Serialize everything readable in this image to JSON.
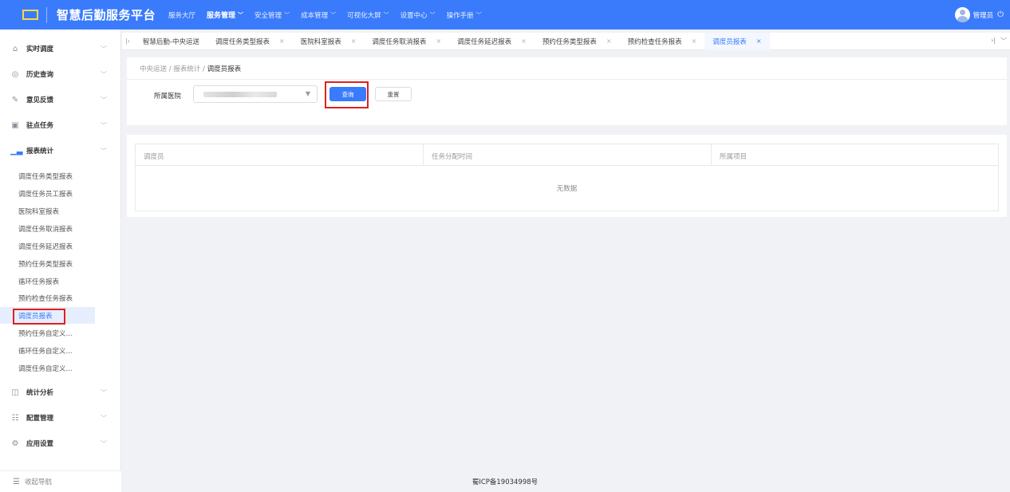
{
  "header": {
    "app_title": "智慧后勤服务平台",
    "nav": [
      {
        "label": "服务大厅",
        "caret": false,
        "active": false
      },
      {
        "label": "服务管理",
        "caret": true,
        "active": true
      },
      {
        "label": "安全管理",
        "caret": true,
        "active": false
      },
      {
        "label": "成本管理",
        "caret": true,
        "active": false
      },
      {
        "label": "可视化大屏",
        "caret": true,
        "active": false
      },
      {
        "label": "设置中心",
        "caret": true,
        "active": false
      },
      {
        "label": "操作手册",
        "caret": true,
        "active": false
      }
    ],
    "user_label": "管理员",
    "colors": {
      "brand": "#3a7bfc",
      "logo": "#f7d84a",
      "highlight": "#e02020"
    }
  },
  "sidebar": {
    "sections_top": [
      {
        "label": "实时调度",
        "icon": "home-icon"
      },
      {
        "label": "历史查询",
        "icon": "history-icon"
      },
      {
        "label": "意见反馈",
        "icon": "edit-icon"
      },
      {
        "label": "驻点任务",
        "icon": "box-icon"
      },
      {
        "label": "报表统计",
        "icon": "bar-chart-icon"
      }
    ],
    "sub_items": [
      {
        "label": "调度任务类型报表",
        "active": false
      },
      {
        "label": "调度任务员工报表",
        "active": false
      },
      {
        "label": "医院科室报表",
        "active": false
      },
      {
        "label": "调度任务取消报表",
        "active": false
      },
      {
        "label": "调度任务延迟报表",
        "active": false
      },
      {
        "label": "预约任务类型报表",
        "active": false
      },
      {
        "label": "循环任务报表",
        "active": false
      },
      {
        "label": "预约检查任务报表",
        "active": false
      },
      {
        "label": "调度员报表",
        "active": true
      },
      {
        "label": "预约任务自定义...",
        "active": false
      },
      {
        "label": "循环任务自定义...",
        "active": false
      },
      {
        "label": "调度任务自定义...",
        "active": false
      }
    ],
    "sections_bottom": [
      {
        "label": "统计分析",
        "icon": "analytics-icon"
      },
      {
        "label": "配置管理",
        "icon": "list-config-icon"
      },
      {
        "label": "应用设置",
        "icon": "settings-icon"
      }
    ],
    "collapse_label": "收起导航"
  },
  "tabs": [
    {
      "label": "智慧后勤-中央运送",
      "closable": false,
      "active": false
    },
    {
      "label": "调度任务类型报表",
      "closable": true,
      "active": false
    },
    {
      "label": "医院科室报表",
      "closable": true,
      "active": false
    },
    {
      "label": "调度任务取消报表",
      "closable": true,
      "active": false
    },
    {
      "label": "调度任务延迟报表",
      "closable": true,
      "active": false
    },
    {
      "label": "预约任务类型报表",
      "closable": true,
      "active": false
    },
    {
      "label": "预约检查任务报表",
      "closable": true,
      "active": false
    },
    {
      "label": "调度员报表",
      "closable": true,
      "active": true
    }
  ],
  "breadcrumb": {
    "root": "中央运送",
    "parent": "报表统计",
    "current": "调度员报表",
    "sep": "/"
  },
  "filter": {
    "hospital_label": "所属医院",
    "query_label": "查询",
    "reset_label": "重置"
  },
  "table": {
    "columns": [
      "调度员",
      "任务分配时间",
      "所属项目"
    ],
    "empty_text": "无数据"
  },
  "footer": {
    "icp": "蜀ICP备19034998号"
  }
}
